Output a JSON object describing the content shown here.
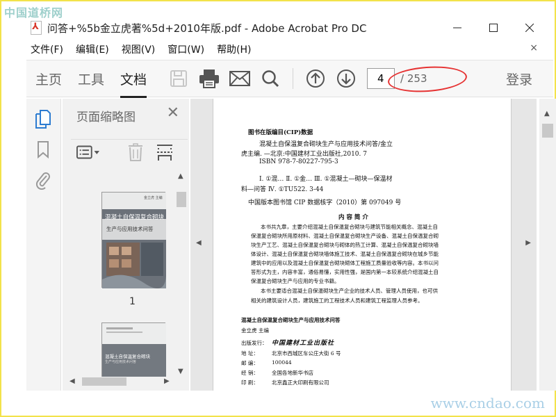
{
  "watermark": {
    "top": "中国道桥网",
    "bottom": "www.cndao.com"
  },
  "window": {
    "title": "问答+%5b金立虎著%5d+2010年版.pdf - Adobe Acrobat Pro DC",
    "minimize_icon": "minimize-icon",
    "maximize_icon": "maximize-icon",
    "close_icon": "close-icon"
  },
  "menu": {
    "items": [
      "文件(F)",
      "编辑(E)",
      "视图(V)",
      "窗口(W)",
      "帮助(H)"
    ],
    "close": "×"
  },
  "toolbar": {
    "tabs": [
      "主页",
      "工具",
      "文档"
    ],
    "active_tab": "文档",
    "page_value": "4",
    "page_total": "/ 253",
    "login": "登录",
    "annotation_color": "#e63232"
  },
  "thumbnails": {
    "title": "页面缩略图",
    "close": "✕",
    "page_labels": [
      "1"
    ],
    "cover1": {
      "author": "金立虎 主编",
      "line1": "混凝土自保温复合砌块",
      "line2": "生产与应用技术问答"
    },
    "cover2": {
      "line1": "混凝土自保温复合砌块",
      "line2": "生产与应用技术问答"
    }
  },
  "document": {
    "cip_title": "图书在版编目(CIP)数据",
    "cip_lines": [
      "混凝土自保温复合砌块生产与应用技术问答/金立",
      "虎主编. —北京:中国建材工业出版社,2010. 7",
      "ISBN 978-7-80227-795-3",
      "Ⅰ. ①混…  Ⅱ. ①金…  Ⅲ. ①混凝土—砌块—保温材",
      "料—问答  Ⅳ. ①TU522. 3-44"
    ],
    "cip_number": "中国版本图书馆 CIP 数据核字（2010）第 097049 号",
    "summary_heading": "内  容  简  介",
    "summary_lines": [
      "本书共九章，主要介绍混凝土自保温复合砌块与建筑节能相关概念、混凝土自",
      "保温复合砌块所用原材料、混凝土自保温复合砌块生产设备、混凝土自保温复合砌",
      "块生产工艺、混凝土自保温复合砌块与砌体的热工计算、混凝土自保温复合砌块墙",
      "体设计、混凝土自保温复合砌块墙体施工技术、混凝土自保温复合砌块在城乡节能",
      "建筑中的应用以及混凝土自保温复合砌块砌体工程施工质量验收等内容。本书以问",
      "答形式为主，内容丰富，通俗易懂，实用性强，是国内第一本较系统介绍混凝土自",
      "保温复合砌块生产与应用的专业书籍。",
      "本书主要适合混凝土自保温砌块生产企业的技术人员、管理人员使用，也可供",
      "相关的建筑设计人员，建筑施工的工程技术人员和建筑工程监理人员参考。"
    ],
    "book_title": "混凝土自保温复合砌块生产与应用技术问答",
    "book_editor": "金立虎  主编",
    "publisher_label": "出版发行：",
    "publisher_name": "中国建材工业出版社",
    "details": [
      {
        "label": "地    址：",
        "value": "北京市西城区车公庄大街 6 号"
      },
      {
        "label": "邮    编：",
        "value": "100044"
      },
      {
        "label": "经    销：",
        "value": "全国各地新华书店"
      },
      {
        "label": "印    刷：",
        "value": "北京鑫正大印刷有限公司"
      }
    ]
  }
}
